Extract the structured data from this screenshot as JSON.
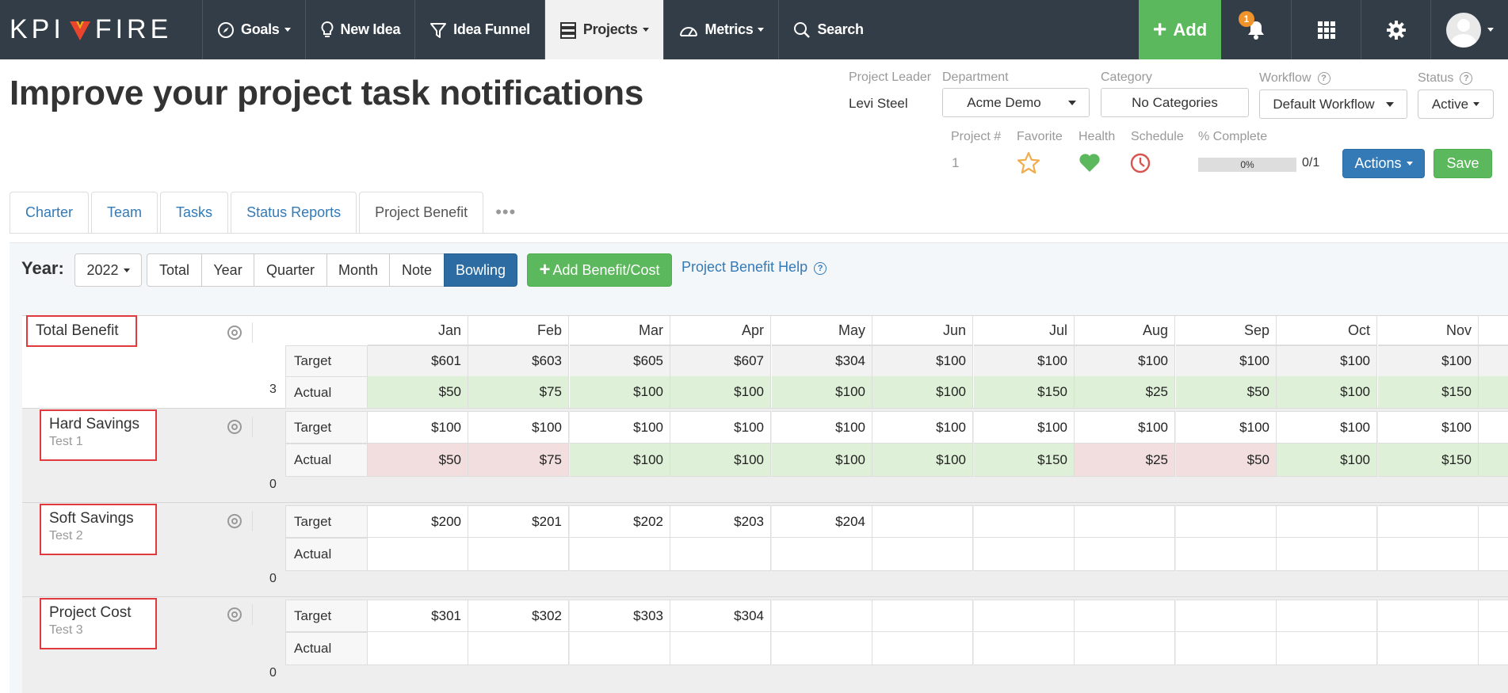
{
  "nav": {
    "logo_left": "KPI",
    "logo_right": "FIRE",
    "items": [
      {
        "label": "Goals",
        "icon": "compass-icon",
        "has_caret": true
      },
      {
        "label": "New Idea",
        "icon": "lightbulb-icon",
        "has_caret": false
      },
      {
        "label": "Idea Funnel",
        "icon": "funnel-icon",
        "has_caret": false
      },
      {
        "label": "Projects",
        "icon": "server-icon",
        "has_caret": true,
        "active": true
      },
      {
        "label": "Metrics",
        "icon": "gauge-icon",
        "has_caret": true
      },
      {
        "label": "Search",
        "icon": "search-icon",
        "has_caret": false
      }
    ],
    "add_label": "Add",
    "notification_count": "1"
  },
  "header": {
    "title": "Improve your project task notifications",
    "project_leader_label": "Project Leader",
    "project_leader": "Levi Steel",
    "department_label": "Department",
    "department": "Acme Demo",
    "category_label": "Category",
    "category": "No Categories",
    "workflow_label": "Workflow",
    "workflow": "Default Workflow",
    "status_label": "Status",
    "status": "Active",
    "project_num_label": "Project #",
    "project_num": "1",
    "favorite_label": "Favorite",
    "health_label": "Health",
    "schedule_label": "Schedule",
    "complete_label": "% Complete",
    "complete_pct": "0%",
    "complete_fraction": "0/1",
    "actions_label": "Actions",
    "save_label": "Save",
    "colors": {
      "health": "#5cb85c",
      "schedule": "#d9534f",
      "favorite": "#f0ad4e"
    }
  },
  "tabs": [
    "Charter",
    "Team",
    "Tasks",
    "Status Reports",
    "Project Benefit"
  ],
  "active_tab": "Project Benefit",
  "toolbar": {
    "year_label": "Year:",
    "year": "2022",
    "views": [
      "Total",
      "Year",
      "Quarter",
      "Month",
      "Note",
      "Bowling"
    ],
    "active_view": "Bowling",
    "add_label": "Add Benefit/Cost",
    "help_label": "Project Benefit Help"
  },
  "grid": {
    "months": [
      "Jan",
      "Feb",
      "Mar",
      "Apr",
      "May",
      "Jun",
      "Jul",
      "Aug",
      "Sep",
      "Oct",
      "Nov"
    ],
    "row_labels": {
      "target": "Target",
      "actual": "Actual"
    },
    "sections": [
      {
        "name": "Total Benefit",
        "sub": "",
        "count": "3",
        "target": [
          "$601",
          "$603",
          "$605",
          "$607",
          "$304",
          "$100",
          "$100",
          "$100",
          "$100",
          "$100",
          "$100"
        ],
        "actual": [
          "$50",
          "$75",
          "$100",
          "$100",
          "$100",
          "$100",
          "$150",
          "$25",
          "$50",
          "$100",
          "$150"
        ],
        "actual_status": [
          "g",
          "g",
          "g",
          "g",
          "g",
          "g",
          "g",
          "g",
          "g",
          "g",
          "g"
        ]
      },
      {
        "name": "Hard Savings",
        "sub": "Test 1",
        "count": "0",
        "target": [
          "$100",
          "$100",
          "$100",
          "$100",
          "$100",
          "$100",
          "$100",
          "$100",
          "$100",
          "$100",
          "$100"
        ],
        "actual": [
          "$50",
          "$75",
          "$100",
          "$100",
          "$100",
          "$100",
          "$150",
          "$25",
          "$50",
          "$100",
          "$150"
        ],
        "actual_status": [
          "r",
          "r",
          "g",
          "g",
          "g",
          "g",
          "g",
          "r",
          "r",
          "g",
          "g"
        ]
      },
      {
        "name": "Soft Savings",
        "sub": "Test 2",
        "count": "0",
        "target": [
          "$200",
          "$201",
          "$202",
          "$203",
          "$204",
          "",
          "",
          "",
          "",
          "",
          ""
        ],
        "actual": [
          "",
          "",
          "",
          "",
          "",
          "",
          "",
          "",
          "",
          "",
          ""
        ],
        "actual_status": [
          "n",
          "n",
          "n",
          "n",
          "n",
          "n",
          "n",
          "n",
          "n",
          "n",
          "n"
        ]
      },
      {
        "name": "Project Cost",
        "sub": "Test 3",
        "count": "0",
        "target": [
          "$301",
          "$302",
          "$303",
          "$304",
          "",
          "",
          "",
          "",
          "",
          "",
          ""
        ],
        "actual": [
          "",
          "",
          "",
          "",
          "",
          "",
          "",
          "",
          "",
          "",
          ""
        ],
        "actual_status": [
          "n",
          "n",
          "n",
          "n",
          "n",
          "n",
          "n",
          "n",
          "n",
          "n",
          "n"
        ]
      }
    ],
    "colors": {
      "good": "#dff0d8",
      "bad": "#f2dede",
      "target_total": "#f2f2f2"
    }
  }
}
